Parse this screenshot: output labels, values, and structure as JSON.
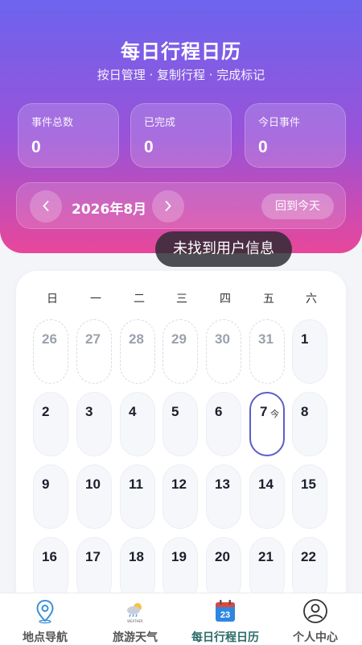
{
  "header": {
    "title": "每日行程日历",
    "subtitle": "按日管理 · 复制行程 · 完成标记"
  },
  "stats": [
    {
      "label": "事件总数",
      "value": "0"
    },
    {
      "label": "已完成",
      "value": "0"
    },
    {
      "label": "今日事件",
      "value": "0"
    }
  ],
  "month_nav": {
    "prev_icon": "chevron-left-icon",
    "month": "2026年8月",
    "next_icon": "chevron-right-icon",
    "today_label": "回到今天"
  },
  "toast": "未找到用户信息",
  "calendar": {
    "weekdays": [
      "日",
      "一",
      "二",
      "三",
      "四",
      "五",
      "六"
    ],
    "days": [
      {
        "label": "26",
        "other": true
      },
      {
        "label": "27",
        "other": true
      },
      {
        "label": "28",
        "other": true
      },
      {
        "label": "29",
        "other": true
      },
      {
        "label": "30",
        "other": true
      },
      {
        "label": "31",
        "other": true
      },
      {
        "label": "1"
      },
      {
        "label": "2"
      },
      {
        "label": "3"
      },
      {
        "label": "4"
      },
      {
        "label": "5"
      },
      {
        "label": "6"
      },
      {
        "label": "7",
        "today": true,
        "tag": "今"
      },
      {
        "label": "8"
      },
      {
        "label": "9"
      },
      {
        "label": "10"
      },
      {
        "label": "11"
      },
      {
        "label": "12"
      },
      {
        "label": "13"
      },
      {
        "label": "14"
      },
      {
        "label": "15"
      },
      {
        "label": "16"
      },
      {
        "label": "17"
      },
      {
        "label": "18"
      },
      {
        "label": "19"
      },
      {
        "label": "20"
      },
      {
        "label": "21"
      },
      {
        "label": "22"
      }
    ]
  },
  "tabs": [
    {
      "label": "地点导航",
      "icon": "location-pin-icon"
    },
    {
      "label": "旅游天气",
      "icon": "weather-icon",
      "icon_text": "WEATHER"
    },
    {
      "label": "每日行程日历",
      "icon": "calendar-icon",
      "icon_text": "23",
      "active": true
    },
    {
      "label": "个人中心",
      "icon": "user-icon"
    }
  ],
  "colors": {
    "header_top": "#6d64ee",
    "header_bottom": "#e8479a",
    "today_border": "#5b5fc7",
    "active_tab": "#2b6b6a"
  }
}
